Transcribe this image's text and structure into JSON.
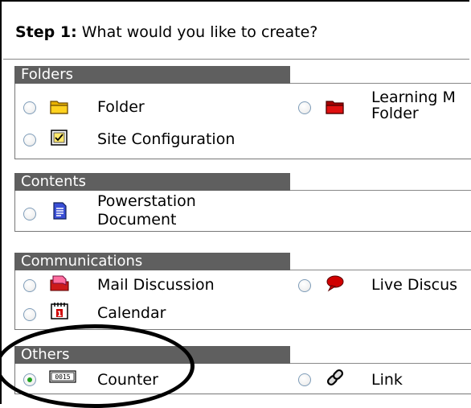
{
  "step": {
    "label": "Step 1:",
    "question": "What would you like to create?"
  },
  "sections": {
    "folders": {
      "title": "Folders",
      "folder": "Folder",
      "learning_line1": "Learning M",
      "learning_line2": "Folder",
      "site_config": "Site Configuration"
    },
    "contents": {
      "title": "Contents",
      "powerstation_line1": "Powerstation",
      "powerstation_line2": "Document"
    },
    "communications": {
      "title": "Communications",
      "mail": "Mail Discussion",
      "live": "Live Discus",
      "calendar": "Calendar"
    },
    "others": {
      "title": "Others",
      "counter": "Counter",
      "counter_icon_text": "0015",
      "link": "Link"
    }
  },
  "selected": "Counter",
  "colors": {
    "header_bg": "#5f5f5f",
    "radio_checked": "#21a121"
  }
}
